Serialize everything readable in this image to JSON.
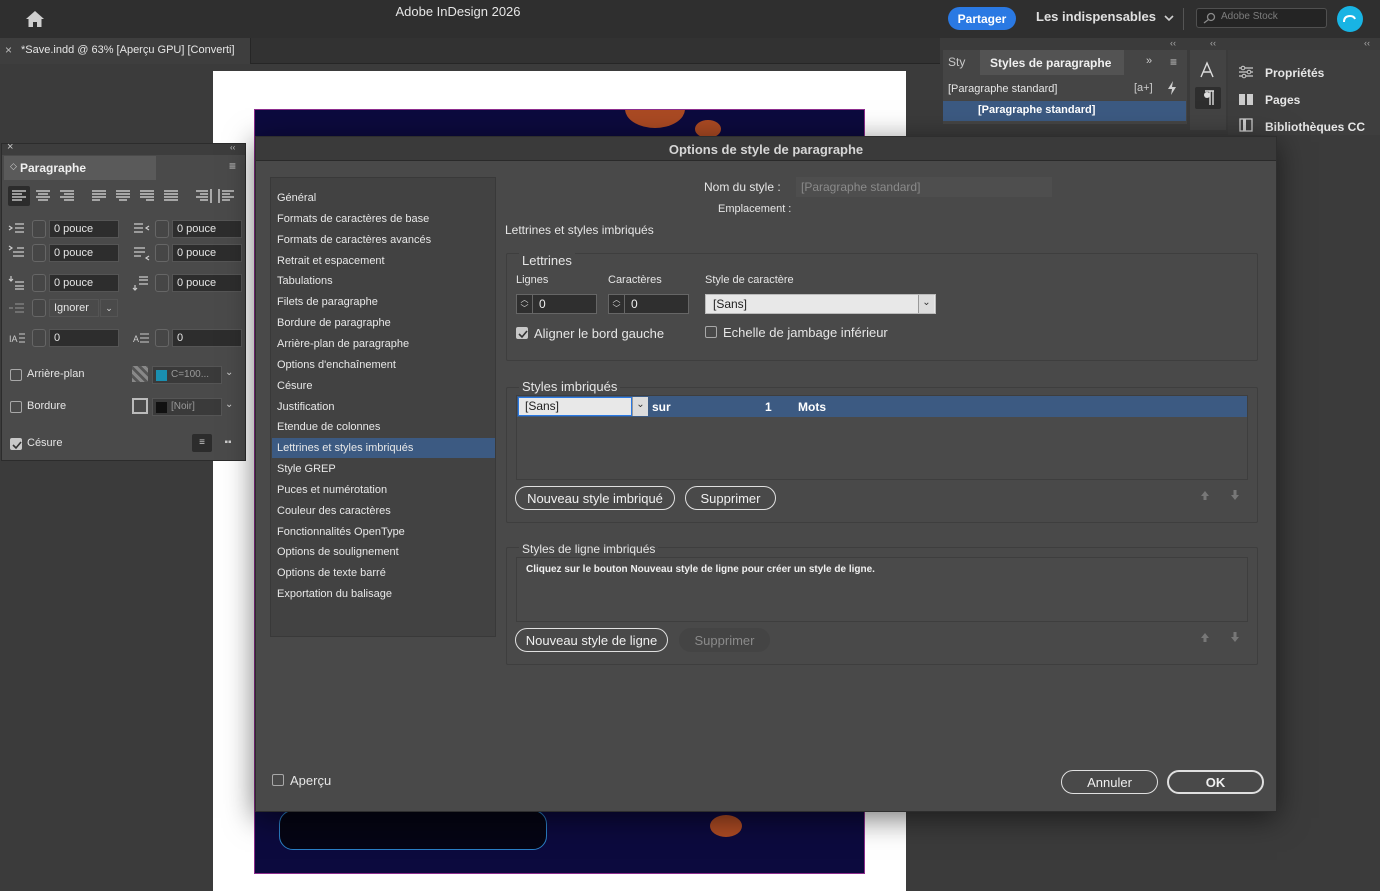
{
  "app": {
    "title": "Adobe InDesign 2026",
    "share_label": "Partager",
    "workspace_label": "Les indispensables",
    "stock_placeholder": "Adobe Stock"
  },
  "document": {
    "tab_label": "*Save.indd @ 63% [Aperçu GPU] [Converti]",
    "tab_close": "×"
  },
  "styles_panel": {
    "tab_short": "Sty",
    "tab_label": "Styles de paragraphe",
    "current_style": "[Paragraphe standard]",
    "list_item": "[Paragraphe standard]",
    "new_style_icon_label": "[a+]"
  },
  "properties_panel": {
    "items": [
      {
        "label": "Propriétés",
        "icon": "properties-icon"
      },
      {
        "label": "Pages",
        "icon": "pages-icon"
      },
      {
        "label": "Bibliothèques CC",
        "icon": "cc-libraries-icon"
      }
    ]
  },
  "paragraph_panel": {
    "title": "Paragraphe",
    "close": "×",
    "left_indent": "0 pouce",
    "right_indent": "0 pouce",
    "first_line_indent": "0 pouce",
    "last_line_indent": "0 pouce",
    "space_before": "0 pouce",
    "space_after": "0 pouce",
    "align_to_grid": "Ignorer",
    "drop_cap_lines": "0",
    "drop_cap_chars": "0",
    "shading_label": "Arrière-plan",
    "shading_color": "C=100...",
    "border_label": "Bordure",
    "border_color": "[Noir]",
    "hyphenate_label": "Césure"
  },
  "dialog": {
    "title": "Options de style de paragraphe",
    "style_name_label": "Nom du style :",
    "style_name_value": "[Paragraphe standard]",
    "location_label": "Emplacement :",
    "section_title": "Lettrines et styles imbriqués",
    "categories": [
      "Général",
      "Formats de caractères de base",
      "Formats de caractères avancés",
      "Retrait et espacement",
      "Tabulations",
      "Filets de paragraphe",
      "Bordure de paragraphe",
      "Arrière-plan de paragraphe",
      "Options d'enchaînement",
      "Césure",
      "Justification",
      "Etendue de colonnes",
      "Lettrines et styles imbriqués",
      "Style GREP",
      "Puces et numérotation",
      "Couleur des caractères",
      "Fonctionnalités OpenType",
      "Options de soulignement",
      "Options de texte barré",
      "Exportation du balisage"
    ],
    "selected_category": "Lettrines et styles imbriqués",
    "drop_caps": {
      "legend": "Lettrines",
      "lines_label": "Lignes",
      "lines_value": "0",
      "chars_label": "Caractères",
      "chars_value": "0",
      "char_style_label": "Style de caractère",
      "char_style_value": "[Sans]",
      "align_left_label": "Aligner le bord gauche",
      "align_left_checked": true,
      "scale_desc_label": "Echelle de jambage inférieur",
      "scale_desc_checked": false
    },
    "nested_styles": {
      "legend": "Styles imbriqués",
      "row": {
        "style": "[Sans]",
        "through": "sur",
        "count": "1",
        "unit": "Mots"
      },
      "new_label": "Nouveau style imbriqué",
      "delete_label": "Supprimer"
    },
    "nested_line_styles": {
      "legend": "Styles de ligne imbriqués",
      "hint": "Cliquez sur le bouton Nouveau style de ligne pour créer un style de ligne.",
      "new_label": "Nouveau style de ligne",
      "delete_label": "Supprimer"
    },
    "preview_label": "Aperçu",
    "cancel_label": "Annuler",
    "ok_label": "OK"
  },
  "colors": {
    "accent": "#2a79e3",
    "selection": "#3c5a82",
    "shading_swatch": "#1a8fb0"
  }
}
